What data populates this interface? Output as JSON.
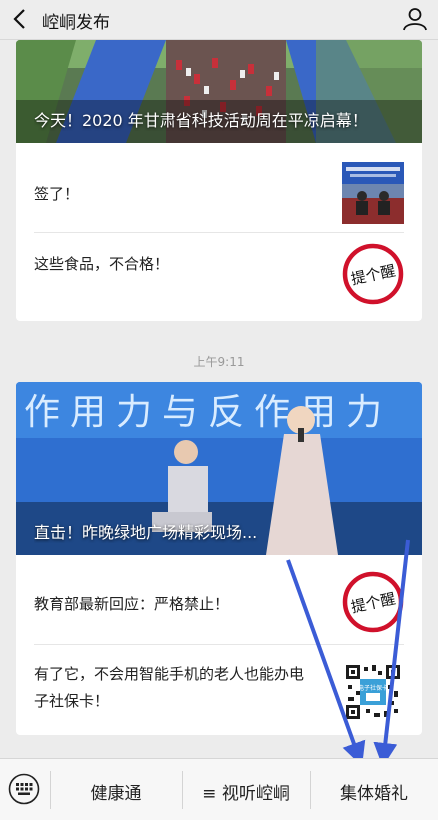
{
  "header": {
    "title": "崆峒发布",
    "back_icon": "back-arrow-icon",
    "profile_icon": "person-icon"
  },
  "card1": {
    "cover_title": "今天！2020 年甘肃省科技活动周在平凉启幕！",
    "items": [
      {
        "text": "签了！"
      },
      {
        "text": "这些食品，不合格！",
        "thumb_text": "提个醒"
      }
    ]
  },
  "timestamp": "上午9:11",
  "card2": {
    "banner_text": "作用力与反作用力",
    "cover_title": "直击！昨晚绿地广场精彩现场...",
    "items": [
      {
        "text": "教育部最新回应：严格禁止！",
        "thumb_text": "提个醒"
      },
      {
        "line1": "有了它，不会用智能手机的老人也能办电",
        "line2": "子社保卡！",
        "thumb_text": "电子社保卡"
      }
    ]
  },
  "bottom_menu": {
    "keyboard_icon": "keyboard-icon",
    "items": [
      {
        "label": "健康通"
      },
      {
        "label": "≡ 视听崆峒"
      },
      {
        "label": "集体婚礼"
      }
    ]
  },
  "colors": {
    "arrow": "#3b5cd6",
    "stamp_red": "#d0112b"
  }
}
